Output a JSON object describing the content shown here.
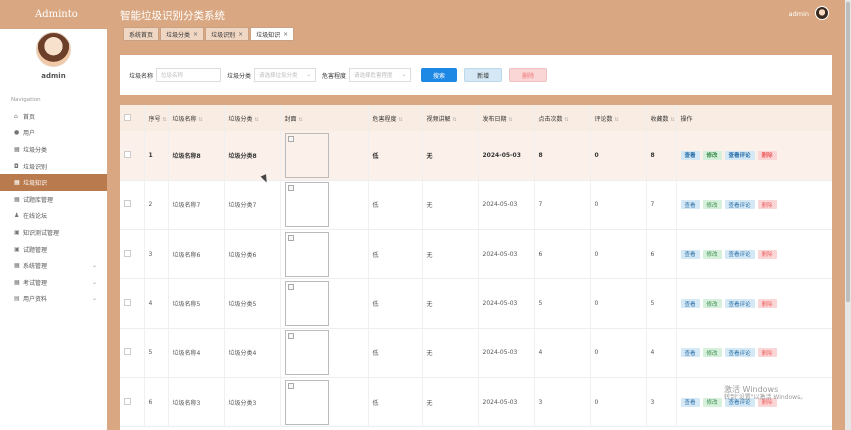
{
  "app": {
    "brand": "Adminto",
    "title": "智能垃圾识别分类系统"
  },
  "sidebar": {
    "username": "admin",
    "nav_title": "Navigation",
    "items": [
      {
        "label": "首页",
        "icon": "home-icon",
        "glyph": "⌂",
        "active": false,
        "expandable": false
      },
      {
        "label": "用户",
        "icon": "user-icon",
        "glyph": "●",
        "active": false,
        "expandable": false
      },
      {
        "label": "垃圾分类",
        "icon": "grid-icon",
        "glyph": "▦",
        "active": false,
        "expandable": false
      },
      {
        "label": "垃圾识别",
        "icon": "camera-icon",
        "glyph": "◘",
        "active": false,
        "expandable": false
      },
      {
        "label": "垃圾知识",
        "icon": "grid-icon",
        "glyph": "▦",
        "active": true,
        "expandable": false
      },
      {
        "label": "试题库管理",
        "icon": "grid-icon",
        "glyph": "▦",
        "active": false,
        "expandable": false
      },
      {
        "label": "在线论坛",
        "icon": "person-icon",
        "glyph": "♟",
        "active": false,
        "expandable": false
      },
      {
        "label": "知识测试管理",
        "icon": "briefcase-icon",
        "glyph": "▣",
        "active": false,
        "expandable": false
      },
      {
        "label": "试题管理",
        "icon": "briefcase-icon",
        "glyph": "▣",
        "active": false,
        "expandable": false
      },
      {
        "label": "系统管理",
        "icon": "grid-icon",
        "glyph": "▦",
        "active": false,
        "expandable": true
      },
      {
        "label": "考试管理",
        "icon": "grid-icon",
        "glyph": "▦",
        "active": false,
        "expandable": true
      },
      {
        "label": "用户资料",
        "icon": "profile-icon",
        "glyph": "▤",
        "active": false,
        "expandable": true
      }
    ]
  },
  "header": {
    "user": "admin"
  },
  "tabs": [
    {
      "label": "系统首页",
      "closable": false,
      "active": false
    },
    {
      "label": "垃圾分类",
      "closable": true,
      "active": false
    },
    {
      "label": "垃圾识别",
      "closable": true,
      "active": false
    },
    {
      "label": "垃圾知识",
      "closable": true,
      "active": true
    }
  ],
  "search": {
    "name_label": "垃圾名称",
    "name_placeholder": "垃圾名称",
    "category_label": "垃圾分类",
    "category_placeholder": "请选择垃圾分类",
    "hazard_label": "危害程度",
    "hazard_placeholder": "请选择危害程度",
    "search_button": "搜索",
    "add_button": "新增",
    "delete_button": "删除"
  },
  "table": {
    "columns": [
      "序号",
      "垃圾名称",
      "垃圾分类",
      "封面",
      "危害程度",
      "视频讲解",
      "发布日期",
      "点击次数",
      "评论数",
      "收藏数",
      "操作"
    ],
    "sortable": [
      true,
      true,
      true,
      true,
      true,
      true,
      true,
      true,
      true,
      true,
      false
    ],
    "cover_alt": "封面",
    "actions": {
      "view": "查看",
      "edit": "修改",
      "comments": "查看评论",
      "delete": "删除"
    },
    "rows": [
      {
        "index": "1",
        "name": "垃圾名称8",
        "category": "垃圾分类8",
        "hazard": "低",
        "video": "无",
        "date": "2024-05-03",
        "clicks": "8",
        "comments": "0",
        "favorites": "8"
      },
      {
        "index": "2",
        "name": "垃圾名称7",
        "category": "垃圾分类7",
        "hazard": "低",
        "video": "无",
        "date": "2024-05-03",
        "clicks": "7",
        "comments": "0",
        "favorites": "7"
      },
      {
        "index": "3",
        "name": "垃圾名称6",
        "category": "垃圾分类6",
        "hazard": "低",
        "video": "无",
        "date": "2024-05-03",
        "clicks": "6",
        "comments": "0",
        "favorites": "6"
      },
      {
        "index": "4",
        "name": "垃圾名称5",
        "category": "垃圾分类5",
        "hazard": "低",
        "video": "无",
        "date": "2024-05-03",
        "clicks": "5",
        "comments": "0",
        "favorites": "5"
      },
      {
        "index": "5",
        "name": "垃圾名称4",
        "category": "垃圾分类4",
        "hazard": "低",
        "video": "无",
        "date": "2024-05-03",
        "clicks": "4",
        "comments": "0",
        "favorites": "4"
      },
      {
        "index": "6",
        "name": "垃圾名称3",
        "category": "垃圾分类3",
        "hazard": "低",
        "video": "无",
        "date": "2024-05-03",
        "clicks": "3",
        "comments": "0",
        "favorites": "3"
      }
    ]
  },
  "watermark": {
    "line1": "激活 Windows",
    "line2": "转到\"设置\"以激活 Windows。"
  }
}
